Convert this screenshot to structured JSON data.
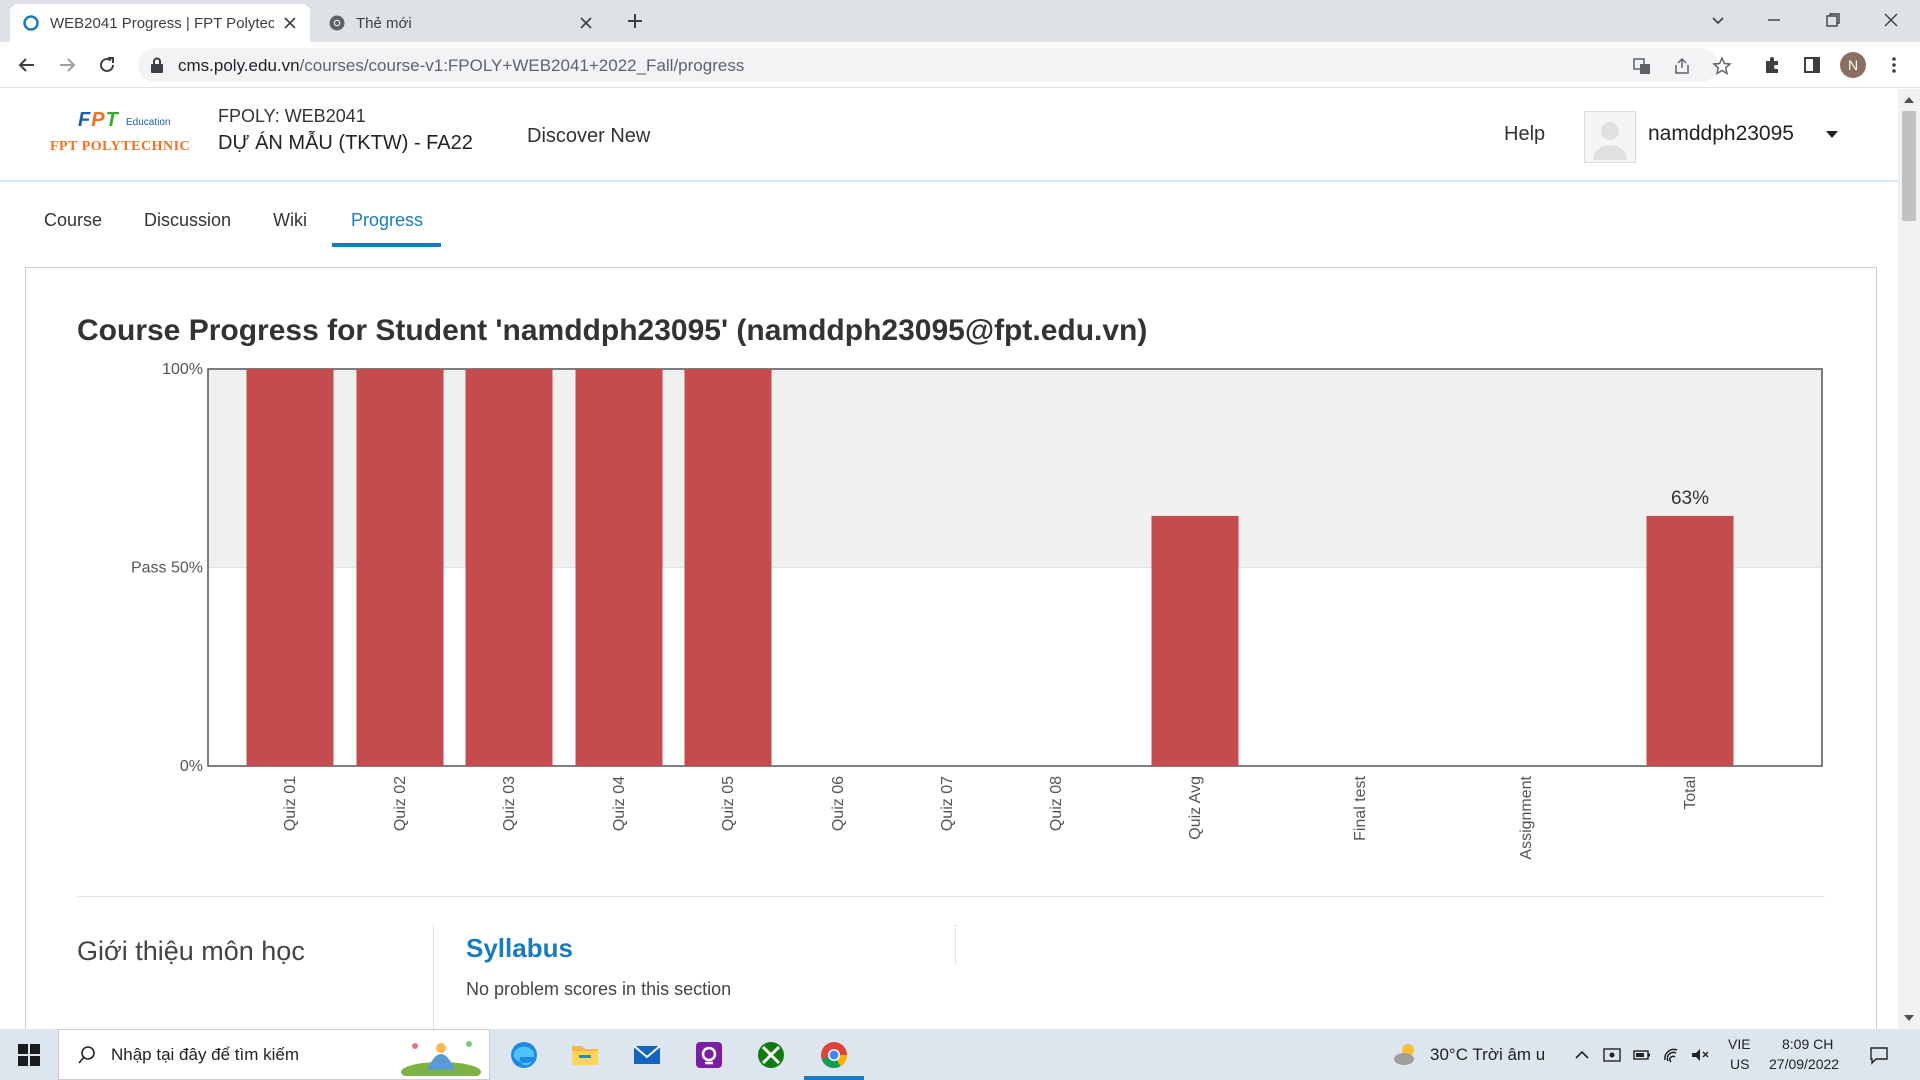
{
  "browser": {
    "tabs": [
      {
        "title": "WEB2041 Progress | FPT Polytech",
        "active": true
      },
      {
        "title": "Thẻ mới",
        "active": false
      }
    ],
    "url_host": "cms.poly.edu.vn",
    "url_path": "/courses/course-v1:FPOLY+WEB2041+2022_Fall/progress",
    "profile_initial": "N"
  },
  "header": {
    "logo_fpt": "FPT",
    "logo_education": "Education",
    "logo_polytechnic": "FPT POLYTECHNIC",
    "course_org": "FPOLY: WEB2041",
    "course_name": "DỰ ÁN MẪU (TKTW) - FA22",
    "discover": "Discover New",
    "help": "Help",
    "username": "namddph23095"
  },
  "course_tabs": [
    "Course",
    "Discussion",
    "Wiki",
    "Progress"
  ],
  "active_tab": "Progress",
  "page_title": "Course Progress for Student 'namddph23095' (namddph23095@fpt.edu.vn)",
  "chart_data": {
    "type": "bar",
    "categories": [
      "Quiz 01",
      "Quiz 02",
      "Quiz 03",
      "Quiz 04",
      "Quiz 05",
      "Quiz 06",
      "Quiz 07",
      "Quiz 08",
      "Quiz Avg",
      "Final test",
      "Assignment",
      "Total"
    ],
    "values": [
      100,
      100,
      100,
      100,
      100,
      0,
      0,
      0,
      63,
      0,
      0,
      63
    ],
    "ylim": [
      0,
      100
    ],
    "yticks": [
      "0%",
      "Pass 50%",
      "100%"
    ],
    "data_labels": {
      "Total": "63%"
    },
    "bar_color": "#c44b4e",
    "pass_band_color": "#f0f0f0"
  },
  "sections": {
    "left_heading": "Giới thiệu môn học",
    "syllabus_heading": "Syllabus",
    "syllabus_note": "No problem scores in this section"
  },
  "taskbar": {
    "search_placeholder": "Nhập tại đây để tìm kiếm",
    "weather": "30°C  Trời âm u",
    "lang_top": "VIE",
    "lang_bottom": "US",
    "time": "8:09 CH",
    "date": "27/09/2022"
  },
  "colors": {
    "accent": "#1a7cbf",
    "bar": "#c44b4e"
  }
}
